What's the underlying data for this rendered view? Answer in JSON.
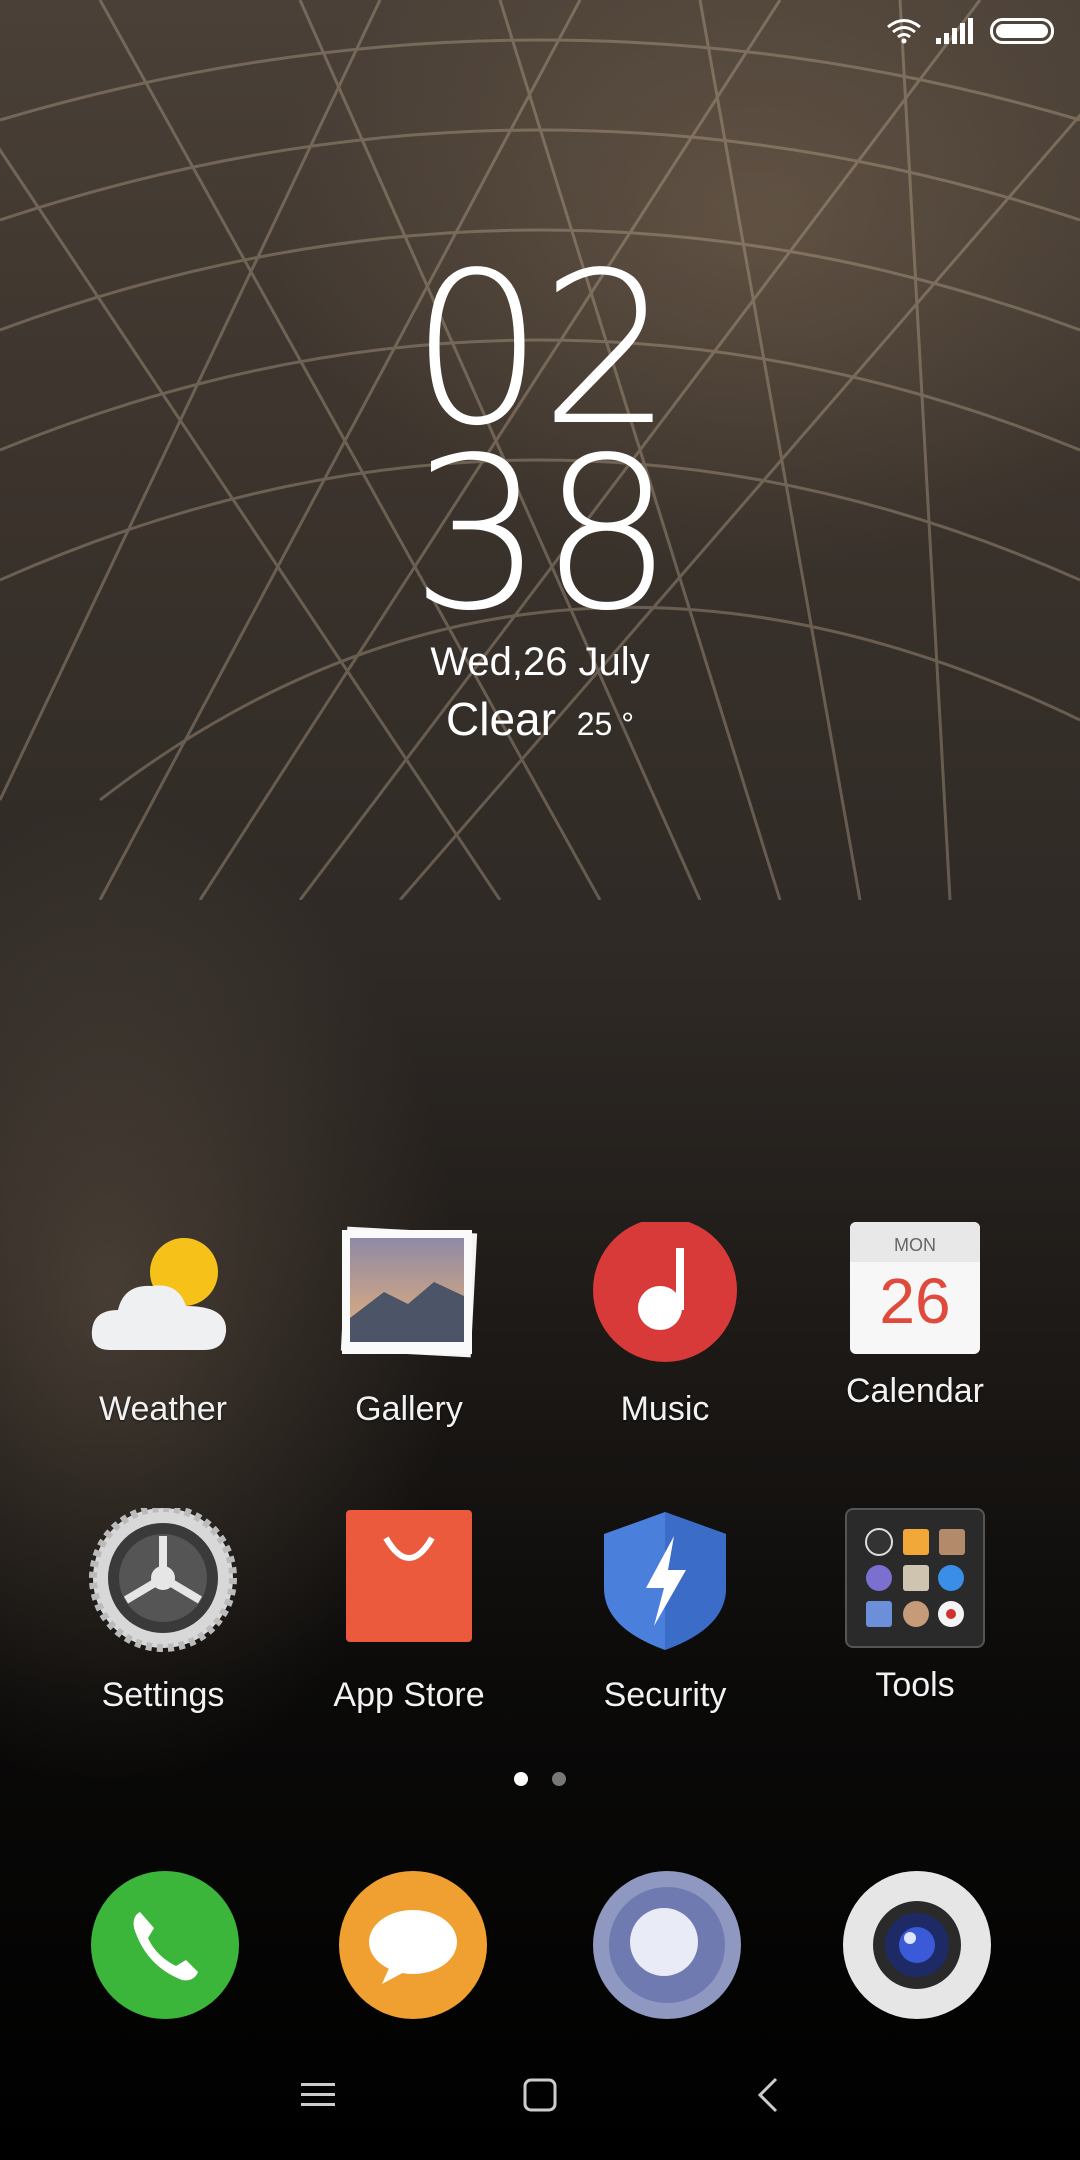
{
  "clock": {
    "hour": "02",
    "minute": "38",
    "date": "Wed,26 July",
    "weather": "Clear",
    "temperature": "25 °"
  },
  "apps_row1": [
    {
      "label": "Weather",
      "icon": "weather-icon"
    },
    {
      "label": "Gallery",
      "icon": "gallery-icon"
    },
    {
      "label": "Music",
      "icon": "music-icon"
    },
    {
      "label": "Calendar",
      "icon": "calendar-icon"
    }
  ],
  "apps_row2": [
    {
      "label": "Settings",
      "icon": "settings-icon"
    },
    {
      "label": "App Store",
      "icon": "app-store-icon"
    },
    {
      "label": "Security",
      "icon": "security-icon"
    },
    {
      "label": "Tools",
      "icon": "tools-folder-icon"
    }
  ],
  "calendar_icon": {
    "weekday": "MON",
    "day": "26"
  },
  "pager": {
    "pages": 2,
    "current": 1
  },
  "dock": [
    {
      "icon": "phone-icon",
      "color": "#3cb63a"
    },
    {
      "icon": "messages-icon",
      "color": "#f0a030"
    },
    {
      "icon": "browser-icon",
      "color": "#8e98c0"
    },
    {
      "icon": "camera-icon",
      "color": "#e6e6e6"
    }
  ],
  "navbar": [
    "menu-icon",
    "home-icon",
    "back-icon"
  ]
}
